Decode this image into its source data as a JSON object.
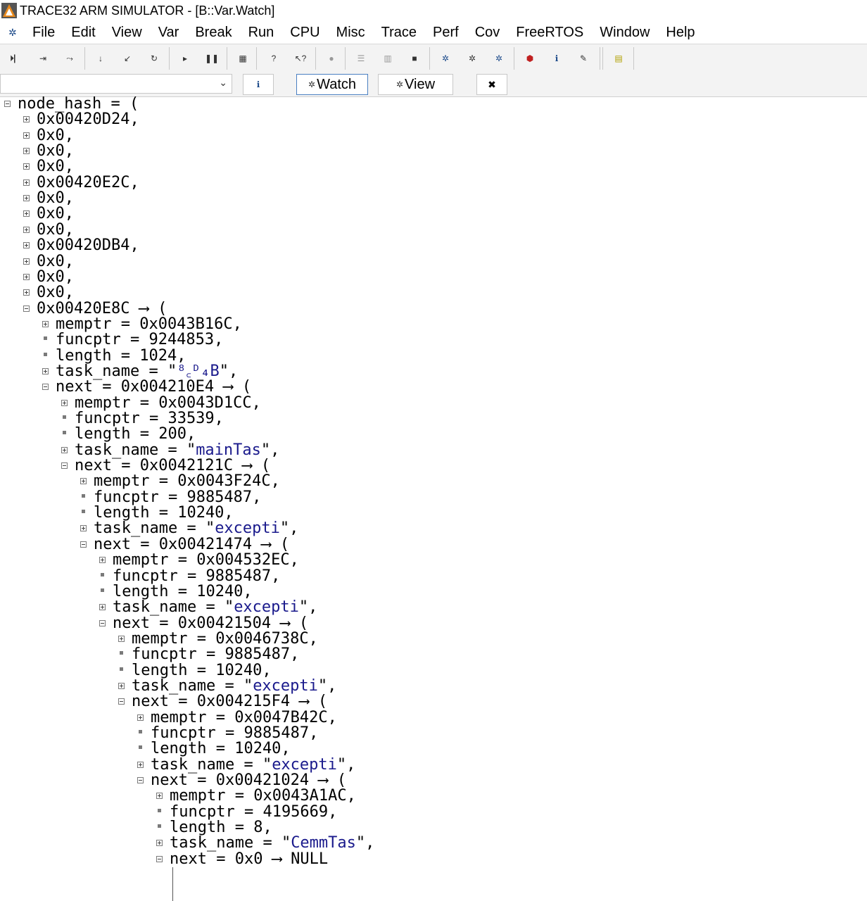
{
  "window": {
    "title": "TRACE32 ARM SIMULATOR - [B::Var.Watch]"
  },
  "menu": {
    "items": [
      "File",
      "Edit",
      "View",
      "Var",
      "Break",
      "Run",
      "CPU",
      "Misc",
      "Trace",
      "Perf",
      "Cov",
      "FreeRTOS",
      "Window",
      "Help"
    ]
  },
  "watch_toolbar": {
    "expression_value": "",
    "watch_label": "Watch",
    "view_label": "View"
  },
  "tree": [
    {
      "level": 0,
      "box": "minus",
      "text": "node_hash = ("
    },
    {
      "level": 1,
      "box": "plus",
      "text": "0x00420D24,"
    },
    {
      "level": 1,
      "box": "plus",
      "text": "0x0,"
    },
    {
      "level": 1,
      "box": "plus",
      "text": "0x0,"
    },
    {
      "level": 1,
      "box": "plus",
      "text": "0x0,"
    },
    {
      "level": 1,
      "box": "plus",
      "text": "0x00420E2C,"
    },
    {
      "level": 1,
      "box": "plus",
      "text": "0x0,"
    },
    {
      "level": 1,
      "box": "plus",
      "text": "0x0,"
    },
    {
      "level": 1,
      "box": "plus",
      "text": "0x0,"
    },
    {
      "level": 1,
      "box": "plus",
      "text": "0x00420DB4,"
    },
    {
      "level": 1,
      "box": "plus",
      "text": "0x0,"
    },
    {
      "level": 1,
      "box": "plus",
      "text": "0x0,"
    },
    {
      "level": 1,
      "box": "plus",
      "text": "0x0,"
    },
    {
      "level": 1,
      "box": "minus",
      "text": "0x00420E8C ⟶ ("
    },
    {
      "level": 2,
      "box": "plus",
      "text": "memptr = 0x0043B16C,"
    },
    {
      "level": 2,
      "box": "dot",
      "text": "funcptr = 9244853,"
    },
    {
      "level": 2,
      "box": "dot",
      "text": "length = 1024,"
    },
    {
      "level": 2,
      "box": "plus",
      "text": "task_name = \"",
      "str": "⁸꜀ᴰ₄B",
      "tail": "\","
    },
    {
      "level": 2,
      "box": "minus",
      "text": "next = 0x004210E4 ⟶ ("
    },
    {
      "level": 3,
      "box": "plus",
      "text": "memptr = 0x0043D1CC,"
    },
    {
      "level": 3,
      "box": "dot",
      "text": "funcptr = 33539,"
    },
    {
      "level": 3,
      "box": "dot",
      "text": "length = 200,"
    },
    {
      "level": 3,
      "box": "plus",
      "text": "task_name = \"",
      "str": "mainTas",
      "tail": "\","
    },
    {
      "level": 3,
      "box": "minus",
      "text": "next = 0x0042121C ⟶ ("
    },
    {
      "level": 4,
      "box": "plus",
      "text": "memptr = 0x0043F24C,"
    },
    {
      "level": 4,
      "box": "dot",
      "text": "funcptr = 9885487,"
    },
    {
      "level": 4,
      "box": "dot",
      "text": "length = 10240,"
    },
    {
      "level": 4,
      "box": "plus",
      "text": "task_name = \"",
      "str": "excepti",
      "tail": "\","
    },
    {
      "level": 4,
      "box": "minus",
      "text": "next = 0x00421474 ⟶ ("
    },
    {
      "level": 5,
      "box": "plus",
      "text": "memptr = 0x004532EC,"
    },
    {
      "level": 5,
      "box": "dot",
      "text": "funcptr = 9885487,"
    },
    {
      "level": 5,
      "box": "dot",
      "text": "length = 10240,"
    },
    {
      "level": 5,
      "box": "plus",
      "text": "task_name = \"",
      "str": "excepti",
      "tail": "\","
    },
    {
      "level": 5,
      "box": "minus",
      "text": "next = 0x00421504 ⟶ ("
    },
    {
      "level": 6,
      "box": "plus",
      "text": "memptr = 0x0046738C,"
    },
    {
      "level": 6,
      "box": "dot",
      "text": "funcptr = 9885487,"
    },
    {
      "level": 6,
      "box": "dot",
      "text": "length = 10240,"
    },
    {
      "level": 6,
      "box": "plus",
      "text": "task_name = \"",
      "str": "excepti",
      "tail": "\","
    },
    {
      "level": 6,
      "box": "minus",
      "text": "next = 0x004215F4 ⟶ ("
    },
    {
      "level": 7,
      "box": "plus",
      "text": "memptr = 0x0047B42C,"
    },
    {
      "level": 7,
      "box": "dot",
      "text": "funcptr = 9885487,"
    },
    {
      "level": 7,
      "box": "dot",
      "text": "length = 10240,"
    },
    {
      "level": 7,
      "box": "plus",
      "text": "task_name = \"",
      "str": "excepti",
      "tail": "\","
    },
    {
      "level": 7,
      "box": "minus",
      "text": "next = 0x00421024 ⟶ ("
    },
    {
      "level": 8,
      "box": "plus",
      "text": "memptr = 0x0043A1AC,"
    },
    {
      "level": 8,
      "box": "dot",
      "text": "funcptr = 4195669,"
    },
    {
      "level": 8,
      "box": "dot",
      "text": "length = 8,"
    },
    {
      "level": 8,
      "box": "plus",
      "text": "task_name = \"",
      "str": "CemmTas",
      "tail": "\","
    },
    {
      "level": 8,
      "box": "minus",
      "text": "next = 0x0 ⟶ NULL"
    }
  ]
}
